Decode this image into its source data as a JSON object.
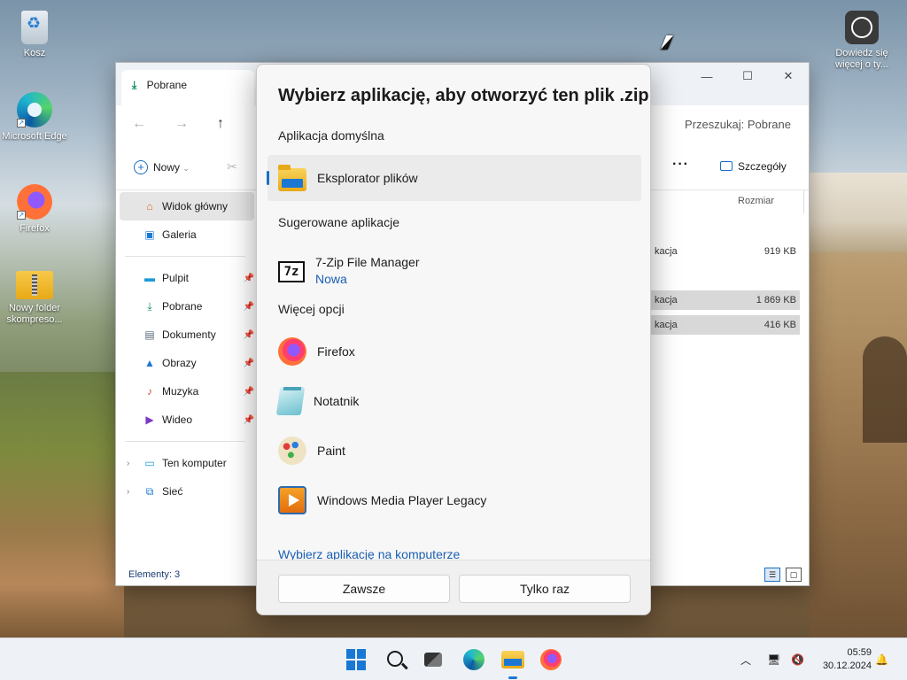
{
  "desktop": {
    "icons": [
      {
        "label": "Kosz"
      },
      {
        "label": "Microsoft Edge"
      },
      {
        "label": "Firefox"
      },
      {
        "label": "Nowy folder skompreso..."
      },
      {
        "label": "Dowiedz się więcej o ty..."
      }
    ]
  },
  "explorer": {
    "tab_title": "Pobrane",
    "search_placeholder": "Przeszukaj: Pobrane",
    "new_label": "Nowy",
    "details_label": "Szczegóły",
    "column_size": "Rozmiar",
    "sidebar": {
      "items": [
        {
          "label": "Widok główny",
          "icon": "home-icon"
        },
        {
          "label": "Galeria",
          "icon": "gallery-icon"
        },
        {
          "label": "Pulpit",
          "icon": "desktop-icon"
        },
        {
          "label": "Pobrane",
          "icon": "download-icon"
        },
        {
          "label": "Dokumenty",
          "icon": "documents-icon"
        },
        {
          "label": "Obrazy",
          "icon": "pictures-icon"
        },
        {
          "label": "Muzyka",
          "icon": "music-icon"
        },
        {
          "label": "Wideo",
          "icon": "video-icon"
        },
        {
          "label": "Ten komputer",
          "icon": "computer-icon"
        },
        {
          "label": "Sieć",
          "icon": "network-icon"
        }
      ]
    },
    "rows": [
      {
        "type": "kacja",
        "size": "919 KB"
      },
      {
        "type": "kacja",
        "size": "1 869 KB"
      },
      {
        "type": "kacja",
        "size": "416 KB"
      }
    ],
    "status": "Elementy: 3"
  },
  "dialog": {
    "title": "Wybierz aplikację, aby otworzyć ten plik .zip",
    "section_default": "Aplikacja domyślna",
    "default_app": "Eksplorator plików",
    "section_suggested": "Sugerowane aplikacje",
    "suggested_app": "7-Zip File Manager",
    "suggested_badge": "Nowa",
    "section_more": "Więcej opcji",
    "more_apps": [
      {
        "label": "Firefox",
        "icon": "firefox-icon"
      },
      {
        "label": "Notatnik",
        "icon": "notepad-icon"
      },
      {
        "label": "Paint",
        "icon": "paint-icon"
      },
      {
        "label": "Windows Media Player Legacy",
        "icon": "media-player-icon"
      }
    ],
    "choose_link": "Wybierz aplikację na komputerze",
    "btn_always": "Zawsze",
    "btn_once": "Tylko raz"
  },
  "taskbar": {
    "time": "05:59",
    "date": "30.12.2024"
  },
  "colors": {
    "accent": "#1a6fc2",
    "link": "#1a5fb4",
    "taskbar_bg": "#eef2f7"
  }
}
